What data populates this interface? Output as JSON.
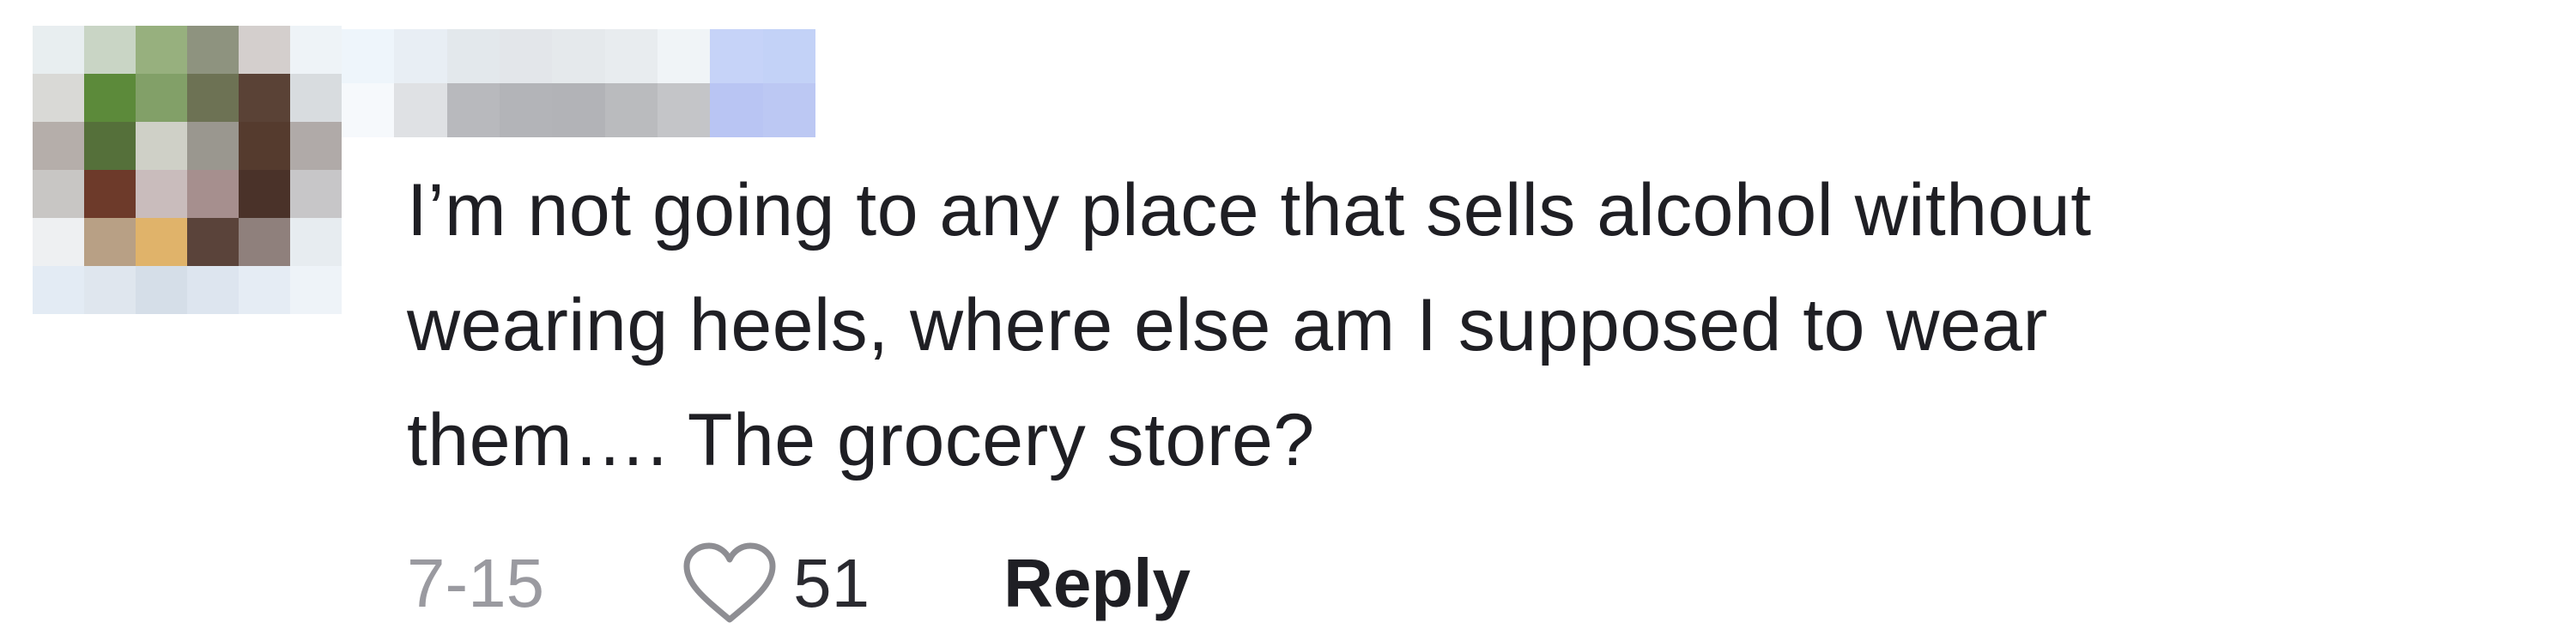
{
  "comment": {
    "avatar_icon": "avatar-pixelated",
    "username_icon": "username-pixelated",
    "text": "I’m not going to any place that sells alcohol without\nwearing heels, where else am I supposed to wear\nthem…. The grocery store?",
    "timestamp": "7-15",
    "like_icon": "heart-outline-icon",
    "like_count": "51",
    "reply_label": "Reply"
  },
  "avatar_pixels": [
    "#e8eef0",
    "#c9d5c5",
    "#97b07e",
    "#8e937f",
    "#d4cfcd",
    "#eef3f7",
    "#d9d9d6",
    "#5c8a3a",
    "#82a068",
    "#6d7254",
    "#5a4236",
    "#d8dcdf",
    "#b5aeaa",
    "#55703a",
    "#cfd0c7",
    "#9a978f",
    "#553b2e",
    "#b0aaa8",
    "#c8c6c4",
    "#6d3a2a",
    "#c9bcbc",
    "#a68f8e",
    "#4a3229",
    "#c7c6c8",
    "#eef0f2",
    "#b8a085",
    "#e0b36a",
    "#5a433a",
    "#8f807c",
    "#e7ecf0",
    "#e3ebf4",
    "#dfe6ee",
    "#d5dee8",
    "#dde5ef",
    "#e5ecf4",
    "#eef3f8"
  ],
  "username_pixels": [
    "#eef5fb",
    "#e8eef4",
    "#e3e8ec",
    "#e3e6ea",
    "#e5e9ec",
    "#e8ecef",
    "#f0f4f7",
    "#c6d3f8",
    "#c3d2f7",
    "#f6f9fc",
    "#dfe1e4",
    "#b8b9bd",
    "#b3b4b8",
    "#b2b3b7",
    "#babbbe",
    "#c4c5c8",
    "#b9c5f3",
    "#bcc8f3"
  ]
}
